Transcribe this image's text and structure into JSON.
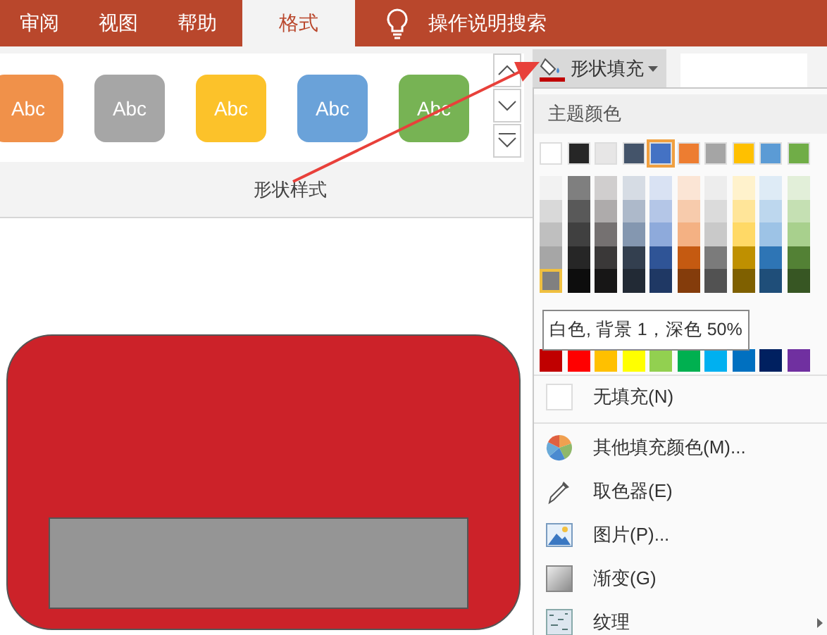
{
  "tabs": [
    {
      "label": "审阅",
      "selected": false
    },
    {
      "label": "视图",
      "selected": false
    },
    {
      "label": "帮助",
      "selected": false
    },
    {
      "label": "格式",
      "selected": true
    }
  ],
  "search": {
    "placeholder": "操作说明搜索"
  },
  "shape_styles": [
    {
      "label": "Abc",
      "color": "#f0914a"
    },
    {
      "label": "Abc",
      "color": "#a6a6a6"
    },
    {
      "label": "Abc",
      "color": "#fcc22a"
    },
    {
      "label": "Abc",
      "color": "#6aa2d9"
    },
    {
      "label": "Abc",
      "color": "#77b354"
    }
  ],
  "group_label": "形状样式",
  "fill_button": {
    "label": "形状填充",
    "color": "#c00000"
  },
  "fill_menu": {
    "theme_heading": "主题颜色",
    "theme_colors": [
      {
        "color": "#ffffff",
        "selected": false,
        "shades": [
          {
            "color": "#f2f2f2",
            "selected": false
          },
          {
            "color": "#d9d9d9",
            "selected": false
          },
          {
            "color": "#bfbfbf",
            "selected": false
          },
          {
            "color": "#a6a6a6",
            "selected": false
          },
          {
            "color": "#808080",
            "selected": true
          }
        ]
      },
      {
        "color": "#262626",
        "selected": false,
        "shades": [
          {
            "color": "#7f7f7f",
            "selected": false
          },
          {
            "color": "#595959",
            "selected": false
          },
          {
            "color": "#404040",
            "selected": false
          },
          {
            "color": "#262626",
            "selected": false
          },
          {
            "color": "#0d0d0d",
            "selected": false
          }
        ]
      },
      {
        "color": "#e7e6e6",
        "selected": false,
        "shades": [
          {
            "color": "#d0cece",
            "selected": false
          },
          {
            "color": "#aeabab",
            "selected": false
          },
          {
            "color": "#757171",
            "selected": false
          },
          {
            "color": "#3a3838",
            "selected": false
          },
          {
            "color": "#171616",
            "selected": false
          }
        ]
      },
      {
        "color": "#44546a",
        "selected": false,
        "shades": [
          {
            "color": "#d6dce4",
            "selected": false
          },
          {
            "color": "#adb9ca",
            "selected": false
          },
          {
            "color": "#8497b0",
            "selected": false
          },
          {
            "color": "#333f4f",
            "selected": false
          },
          {
            "color": "#222a35",
            "selected": false
          }
        ]
      },
      {
        "color": "#4472c4",
        "selected": true,
        "shades": [
          {
            "color": "#d9e2f3",
            "selected": false
          },
          {
            "color": "#b4c6e7",
            "selected": false
          },
          {
            "color": "#8eaadb",
            "selected": false
          },
          {
            "color": "#2f5496",
            "selected": false
          },
          {
            "color": "#1f3864",
            "selected": false
          }
        ]
      },
      {
        "color": "#ed7d31",
        "selected": false,
        "shades": [
          {
            "color": "#fbe5d5",
            "selected": false
          },
          {
            "color": "#f7cbac",
            "selected": false
          },
          {
            "color": "#f4b183",
            "selected": false
          },
          {
            "color": "#c55a11",
            "selected": false
          },
          {
            "color": "#843c0b",
            "selected": false
          }
        ]
      },
      {
        "color": "#a5a5a5",
        "selected": false,
        "shades": [
          {
            "color": "#ededed",
            "selected": false
          },
          {
            "color": "#dbdbdb",
            "selected": false
          },
          {
            "color": "#c9c9c9",
            "selected": false
          },
          {
            "color": "#7b7b7b",
            "selected": false
          },
          {
            "color": "#525252",
            "selected": false
          }
        ]
      },
      {
        "color": "#ffc000",
        "selected": false,
        "shades": [
          {
            "color": "#fff2cc",
            "selected": false
          },
          {
            "color": "#ffe599",
            "selected": false
          },
          {
            "color": "#ffd966",
            "selected": false
          },
          {
            "color": "#bf9000",
            "selected": false
          },
          {
            "color": "#7f6000",
            "selected": false
          }
        ]
      },
      {
        "color": "#5b9bd5",
        "selected": false,
        "shades": [
          {
            "color": "#deebf6",
            "selected": false
          },
          {
            "color": "#bdd7ee",
            "selected": false
          },
          {
            "color": "#9dc3e6",
            "selected": false
          },
          {
            "color": "#2e75b5",
            "selected": false
          },
          {
            "color": "#1f4e79",
            "selected": false
          }
        ]
      },
      {
        "color": "#70ad47",
        "selected": false,
        "shades": [
          {
            "color": "#e2efd9",
            "selected": false
          },
          {
            "color": "#c5e0b3",
            "selected": false
          },
          {
            "color": "#a8d08d",
            "selected": false
          },
          {
            "color": "#538135",
            "selected": false
          },
          {
            "color": "#375623",
            "selected": false
          }
        ]
      }
    ],
    "standard_colors": [
      {
        "color": "#c00000"
      },
      {
        "color": "#ff0000"
      },
      {
        "color": "#ffc000"
      },
      {
        "color": "#ffff00"
      },
      {
        "color": "#92d050"
      },
      {
        "color": "#00b050"
      },
      {
        "color": "#00b0f0"
      },
      {
        "color": "#0070c0"
      },
      {
        "color": "#002060"
      },
      {
        "color": "#7030a0"
      }
    ],
    "tooltip": "白色, 背景 1，深色 50%",
    "items": [
      {
        "kind": "none",
        "label": "无填充(N)"
      },
      {
        "kind": "more",
        "label": "其他填充颜色(M)..."
      },
      {
        "kind": "eyedropper",
        "label": "取色器(E)"
      },
      {
        "kind": "picture",
        "label": "图片(P)..."
      },
      {
        "kind": "gradient",
        "label": "渐变(G)"
      },
      {
        "kind": "texture",
        "label": "纹理",
        "submenu": true
      }
    ]
  }
}
